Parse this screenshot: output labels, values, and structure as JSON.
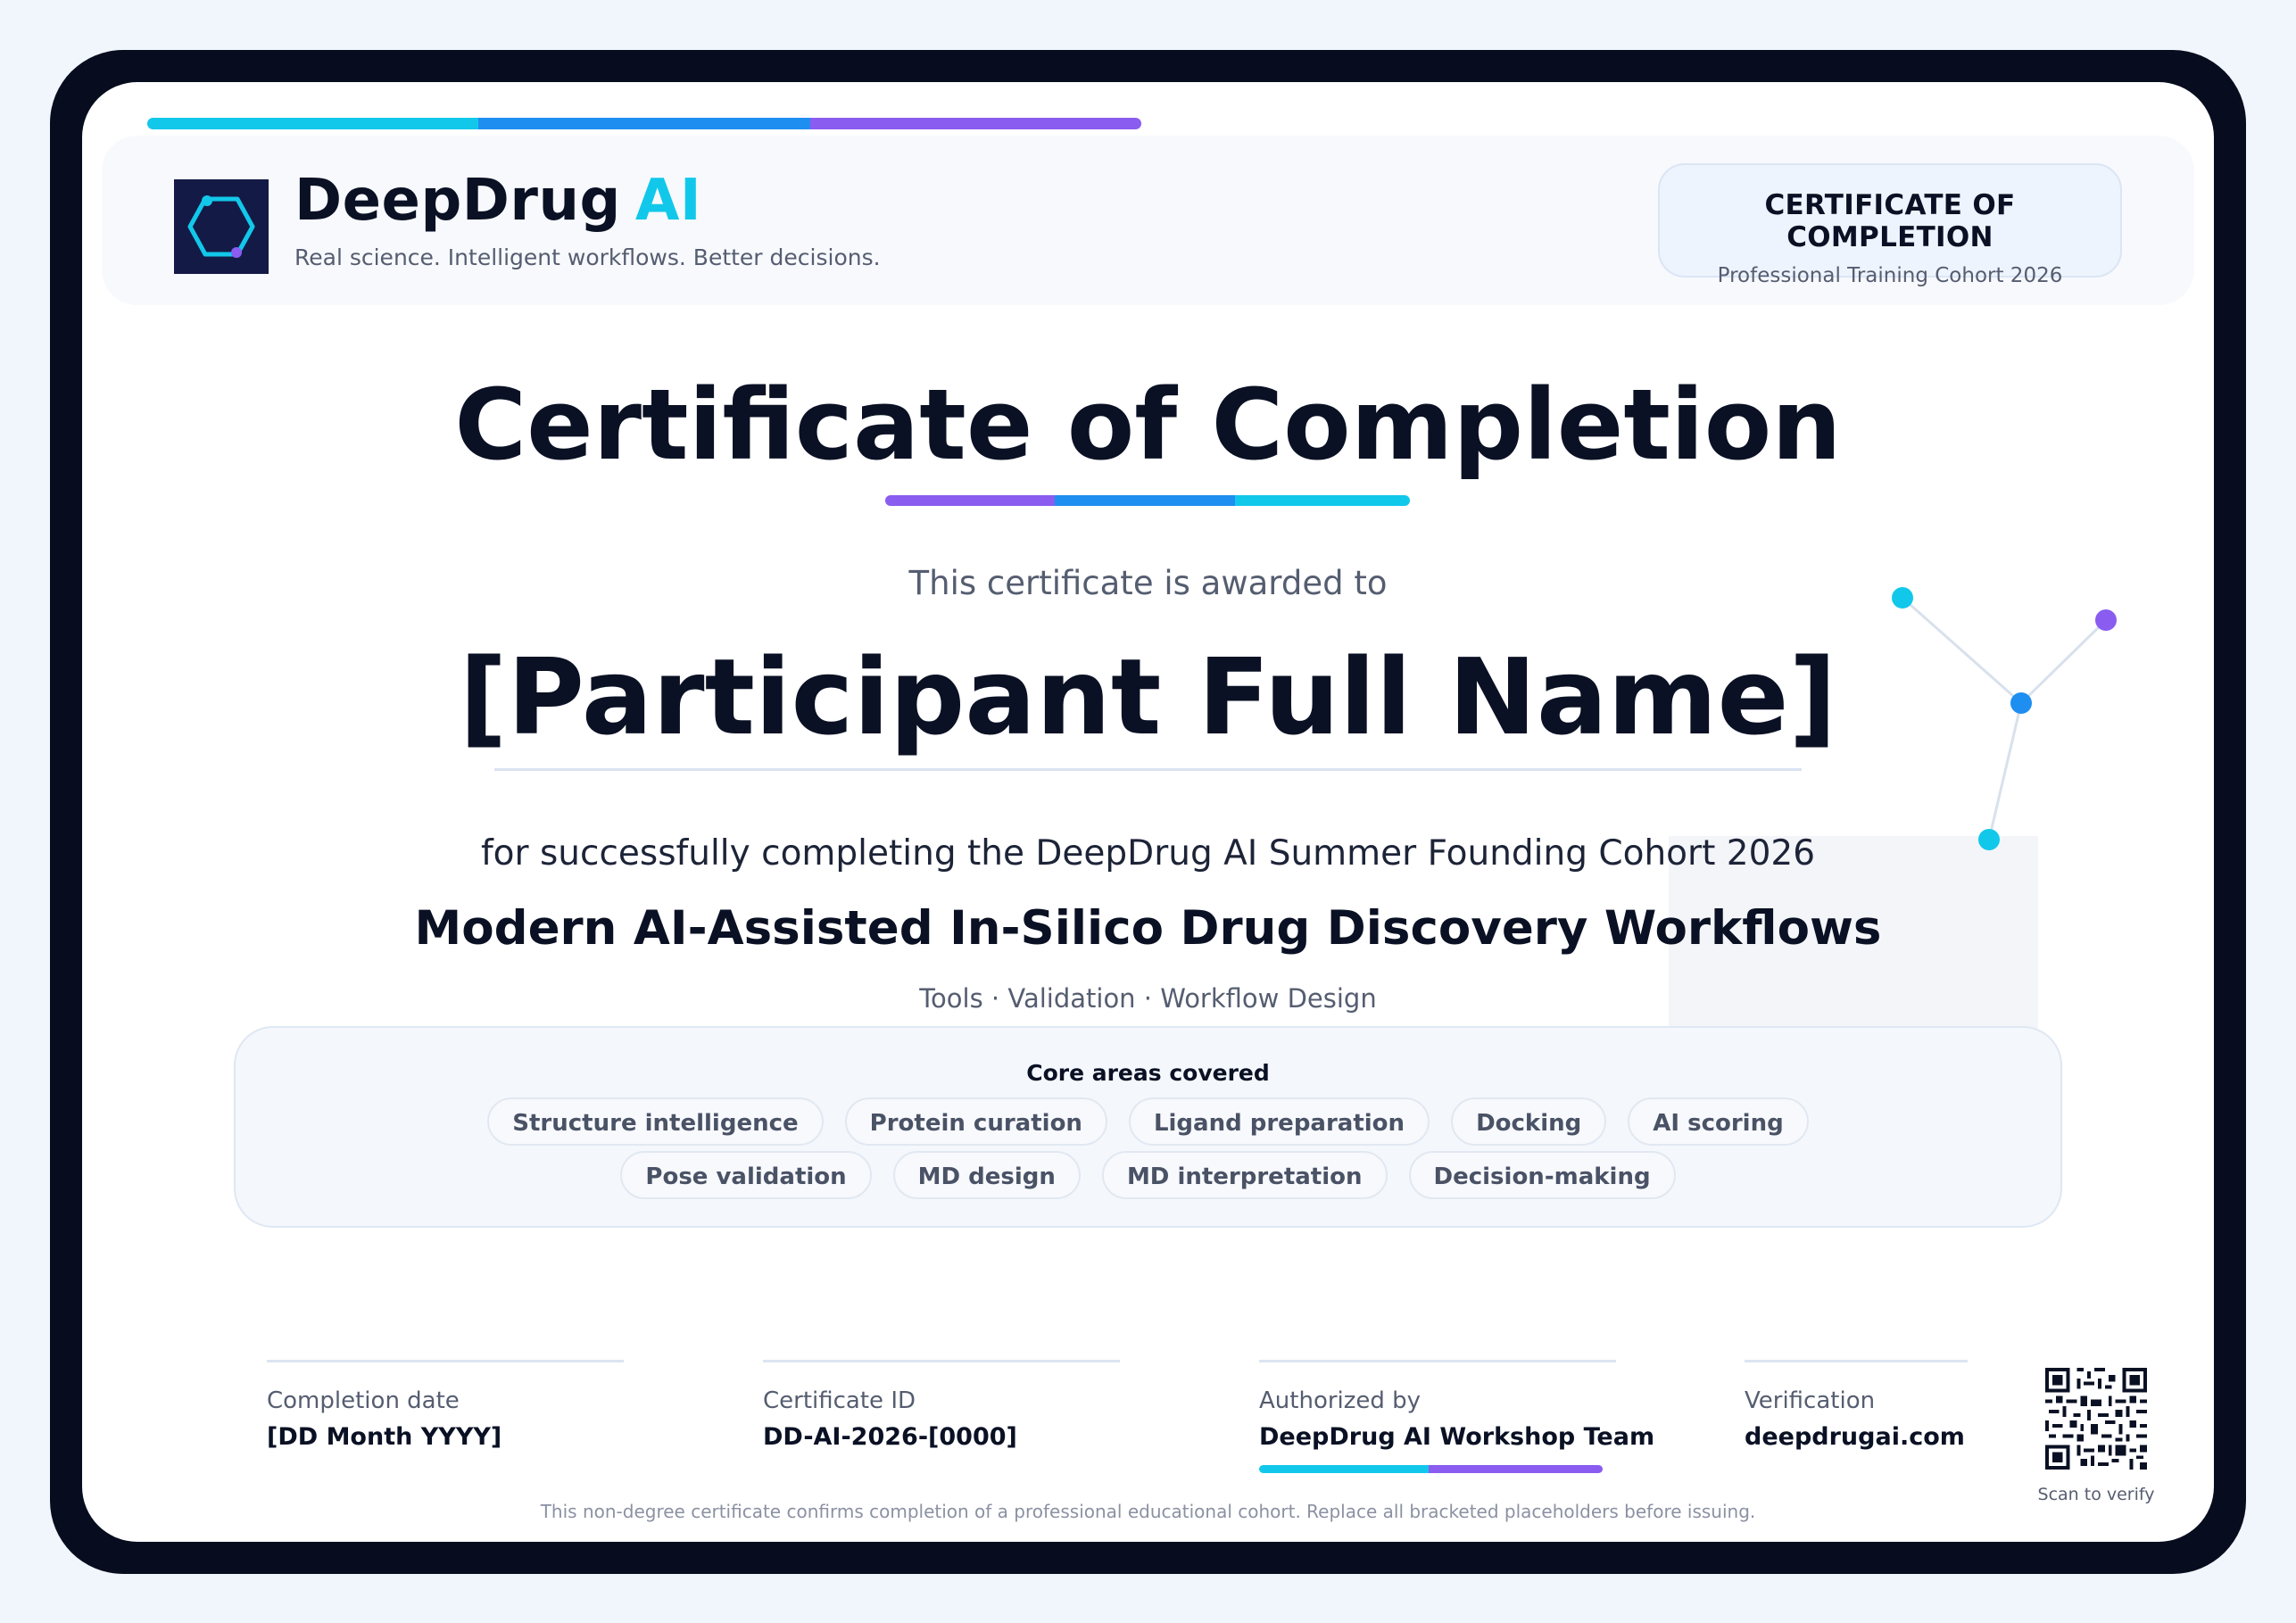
{
  "brand": {
    "name": "DeepDrug",
    "name_accent": "AI",
    "tagline": "Real science. Intelligent workflows. Better decisions.",
    "logo_icon": "hexagon-molecule-icon"
  },
  "badge": {
    "title": "CERTIFICATE OF COMPLETION",
    "subtitle": "Professional Training Cohort 2026"
  },
  "certificate": {
    "title": "Certificate of Completion",
    "awarded_to_label": "This certificate is awarded to",
    "participant_name": "[Participant Full Name]",
    "for_text": "for successfully completing the DeepDrug AI Summer Founding Cohort 2026",
    "course_title": "Modern AI-Assisted In-Silico Drug Discovery Workflows",
    "course_subline": "Tools · Validation · Workflow Design"
  },
  "core_areas": {
    "title": "Core areas covered",
    "row1": [
      "Structure intelligence",
      "Protein curation",
      "Ligand preparation",
      "Docking",
      "AI scoring"
    ],
    "row2": [
      "Pose validation",
      "MD design",
      "MD interpretation",
      "Decision-making"
    ]
  },
  "footer": {
    "completion_date_label": "Completion date",
    "completion_date_value": "[DD Month YYYY]",
    "certificate_id_label": "Certificate ID",
    "certificate_id_value": "DD-AI-2026-[0000]",
    "authorized_by_label": "Authorized by",
    "authorized_by_value": "DeepDrug AI Workshop Team",
    "verification_label": "Verification",
    "verification_value": "deepdrugai.com",
    "qr_caption": "Scan to verify",
    "disclaimer": "This non-degree certificate confirms completion of a professional educational cohort. Replace all bracketed placeholders before issuing."
  },
  "colors": {
    "dark": "#070d1f",
    "cyan": "#12c8ea",
    "blue": "#1f8ef1",
    "purple": "#8a5cf0",
    "text_dark": "#0b1124",
    "text_muted": "#555d70"
  }
}
